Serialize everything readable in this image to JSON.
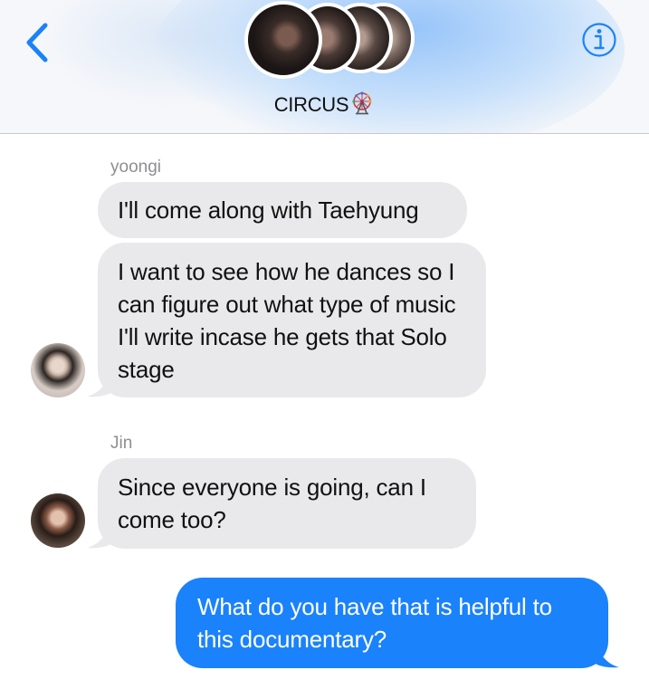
{
  "header": {
    "group_name": "CIRCUS",
    "group_emoji_icon": "ferris-wheel-icon",
    "back_icon": "chevron-left-icon",
    "info_icon": "info-icon",
    "accent_color": "#1a82fb"
  },
  "messages": [
    {
      "sender": "yoongi",
      "text": "I'll come along with Taehyung",
      "direction": "incoming"
    },
    {
      "sender": "yoongi",
      "text": "I want to see how he dances so I can figure out what type of music I'll write incase he gets that Solo stage",
      "direction": "incoming"
    },
    {
      "sender": "Jin",
      "text": "Since everyone is going, can I come too?",
      "direction": "incoming"
    },
    {
      "sender": "me",
      "text": "What do you have that is helpful to this documentary?",
      "direction": "outgoing"
    }
  ]
}
